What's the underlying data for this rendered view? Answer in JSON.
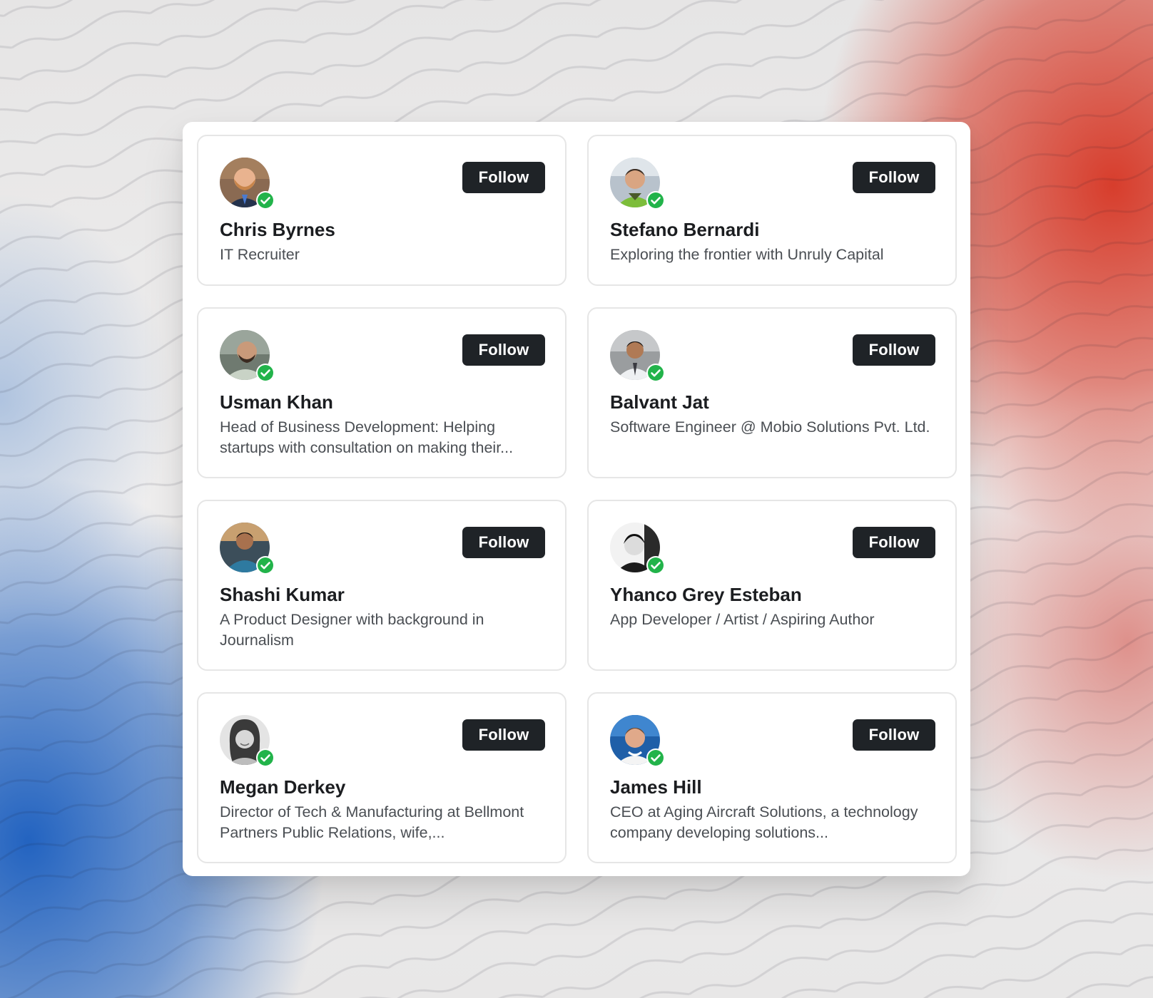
{
  "colors": {
    "background": "#e9e7e6",
    "accent_red": "#d63422",
    "accent_blue": "#185cbe",
    "button": "#1f2327",
    "verified": "#22b34a"
  },
  "people": [
    {
      "name": "Chris Byrnes",
      "headline": "IT Recruiter",
      "follow_label": "Follow",
      "verified": true,
      "avatar_icon": "photo-avatar"
    },
    {
      "name": "Stefano Bernardi",
      "headline": "Exploring the frontier with Unruly Capital",
      "follow_label": "Follow",
      "verified": true,
      "avatar_icon": "photo-avatar"
    },
    {
      "name": "Usman Khan",
      "headline": "Head of Business Development: Helping startups with consultation on making their...",
      "follow_label": "Follow",
      "verified": true,
      "avatar_icon": "photo-avatar"
    },
    {
      "name": "Balvant Jat",
      "headline": "Software Engineer @ Mobio Solutions Pvt. Ltd.",
      "follow_label": "Follow",
      "verified": true,
      "avatar_icon": "photo-avatar"
    },
    {
      "name": "Shashi Kumar",
      "headline": "A Product Designer with background in Journalism",
      "follow_label": "Follow",
      "verified": true,
      "avatar_icon": "photo-avatar"
    },
    {
      "name": "Yhanco Grey Esteban",
      "headline": "App Developer / Artist / Aspiring Author",
      "follow_label": "Follow",
      "verified": true,
      "avatar_icon": "photo-avatar"
    },
    {
      "name": "Megan Derkey",
      "headline": "Director of Tech & Manufacturing at Bellmont Partners Public Relations, wife,...",
      "follow_label": "Follow",
      "verified": true,
      "avatar_icon": "photo-avatar"
    },
    {
      "name": "James Hill",
      "headline": "CEO at Aging Aircraft Solutions, a technology company developing solutions...",
      "follow_label": "Follow",
      "verified": true,
      "avatar_icon": "photo-avatar"
    }
  ]
}
